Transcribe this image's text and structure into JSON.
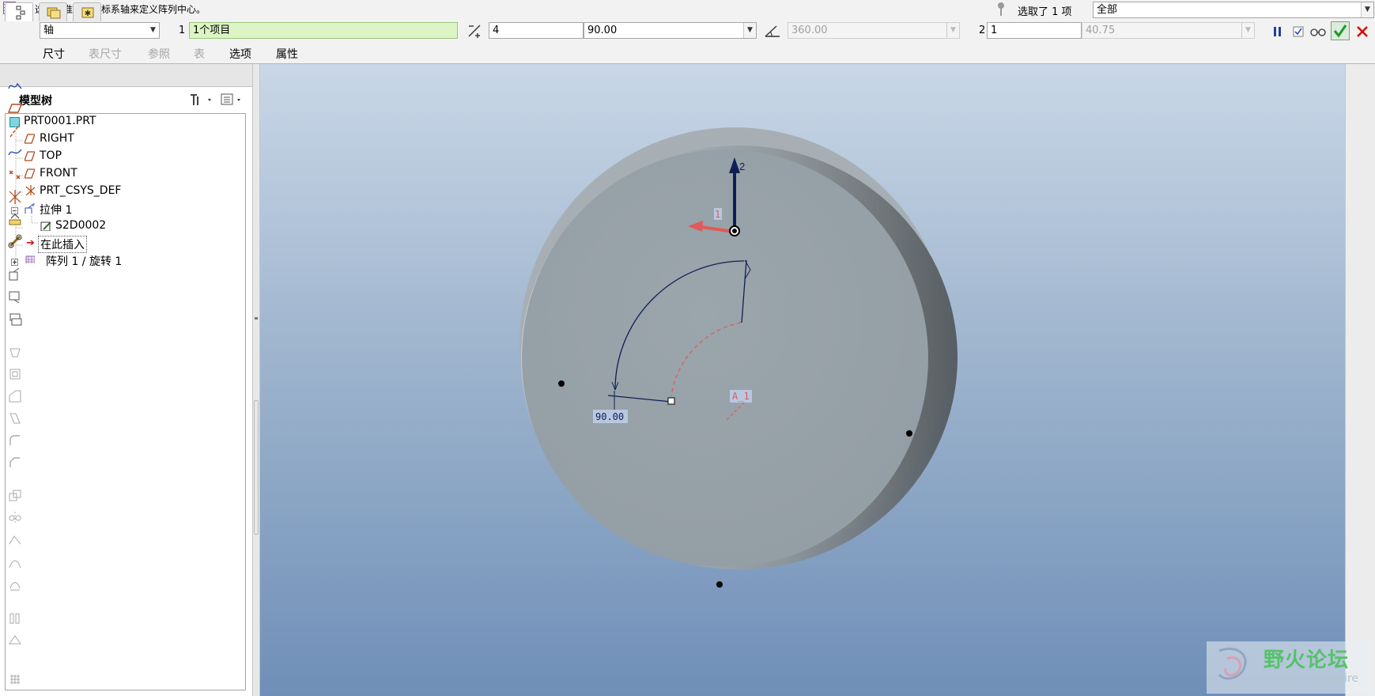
{
  "dashboard": {
    "prompt": "选取基准轴、坐标系轴来定义阵列中心。",
    "selection_status": "选取了 1 项",
    "filter_value": "全部",
    "pattern_type": "轴",
    "first_dir_index": "1",
    "first_dir_collector": "1个项目",
    "member_count": "4",
    "angle_increment": "90.00",
    "angular_extent": "360.00",
    "second_dir_index": "2",
    "second_dir_count": "1",
    "second_dir_spacing": "40.75",
    "tabs": [
      {
        "label": "尺寸",
        "enabled": true
      },
      {
        "label": "表尺寸",
        "enabled": false
      },
      {
        "label": "参照",
        "enabled": false
      },
      {
        "label": "表",
        "enabled": false
      },
      {
        "label": "选项",
        "enabled": true
      },
      {
        "label": "属性",
        "enabled": true
      }
    ]
  },
  "navigator": {
    "title": "模型树",
    "tree": [
      {
        "label": "PRT0001.PRT",
        "icon": "part-icon"
      },
      {
        "label": "RIGHT",
        "icon": "datum-plane-icon"
      },
      {
        "label": "TOP",
        "icon": "datum-plane-icon"
      },
      {
        "label": "FRONT",
        "icon": "datum-plane-icon"
      },
      {
        "label": "PRT_CSYS_DEF",
        "icon": "csys-icon"
      },
      {
        "label": "拉伸 1",
        "icon": "extrude-icon"
      },
      {
        "label": "S2D0002",
        "icon": "sketch-icon"
      },
      {
        "label": "在此插入",
        "icon": "insert-arrow-icon"
      },
      {
        "label": "阵列 1 / 旋转 1",
        "icon": "pattern-icon"
      }
    ]
  },
  "viewport": {
    "dir1_marker": "2",
    "dir2_marker": "1",
    "axis_label": "A_1",
    "angle_dim": "90.00",
    "pattern_points": 4
  },
  "watermark": {
    "title": "野火论坛",
    "url": "www.proewildfire"
  },
  "colors": {
    "ok_green": "#1d9a28",
    "cancel_red": "#d21010",
    "collector_bg": "#ddf5c4",
    "datum_red": "#e05a5a",
    "direction_navy": "#0f1f55"
  }
}
